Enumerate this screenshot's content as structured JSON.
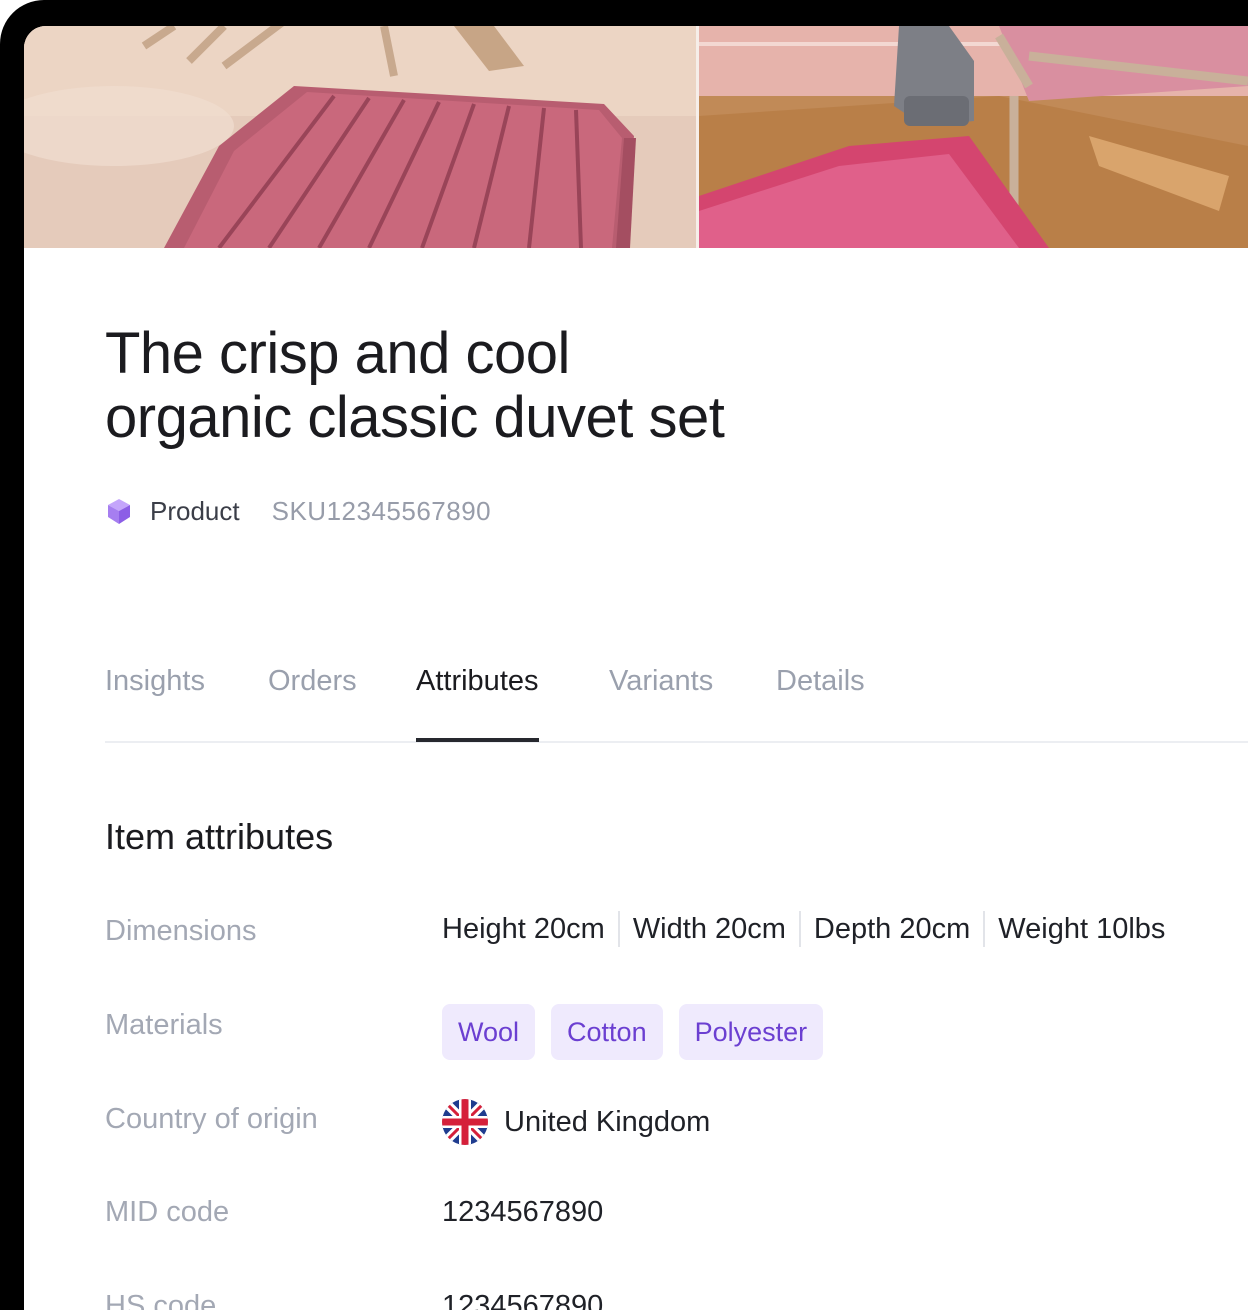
{
  "product": {
    "title": "The crisp and cool\norganic classic duvet set",
    "type_label": "Product",
    "sku": "SKU12345567890"
  },
  "tabs": [
    {
      "label": "Insights",
      "active": false
    },
    {
      "label": "Orders",
      "active": false
    },
    {
      "label": "Attributes",
      "active": true
    },
    {
      "label": "Variants",
      "active": false
    },
    {
      "label": "Details",
      "active": false
    }
  ],
  "attributes": {
    "section_title": "Item attributes",
    "dimensions": {
      "label": "Dimensions",
      "values": [
        "Height 20cm",
        "Width 20cm",
        "Depth 20cm",
        "Weight 10lbs"
      ]
    },
    "materials": {
      "label": "Materials",
      "values": [
        "Wool",
        "Cotton",
        "Polyester"
      ]
    },
    "country": {
      "label": "Country of origin",
      "value": "United Kingdom",
      "flag_icon": "uk-flag-icon"
    },
    "mid_code": {
      "label": "MID code",
      "value": "1234567890"
    },
    "hs_code": {
      "label": "HS code",
      "value": "1234567890"
    }
  },
  "icons": {
    "type_icon": "cube-icon"
  },
  "colors": {
    "accent": "#6b3fd1",
    "chip_background": "#efeafd",
    "type_icon": "#a67ef0"
  }
}
